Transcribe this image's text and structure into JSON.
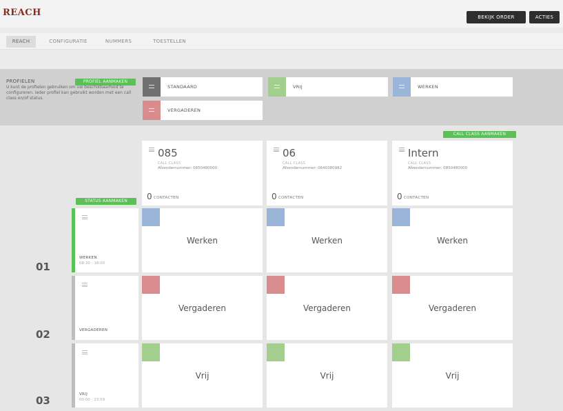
{
  "app": {
    "title": "REACH"
  },
  "header": {
    "order_button": "BEKIJK ORDER",
    "actions_button": "ACTIES"
  },
  "tabs": [
    "REACH",
    "CONFIGURATIE",
    "NUMMERS",
    "TOESTELLEN"
  ],
  "profiles": {
    "title": "PROFIELEN",
    "add_button": "PROFIEL AANMAKEN",
    "description": "U kunt de profielen gebruiken om uw beschikbaarheid te configureren. Ieder profiel kan gebruikt worden met een call class en/of status.",
    "items": [
      {
        "name": "STANDAARD",
        "color": "#707070"
      },
      {
        "name": "VRIJ",
        "color": "#a3cf8e"
      },
      {
        "name": "WERKEN",
        "color": "#9ab5d8"
      },
      {
        "name": "VERGADEREN",
        "color": "#d88c8e"
      }
    ]
  },
  "call_classes": {
    "add_button": "CALL CLASS AANMAKEN",
    "items": [
      {
        "name": "085",
        "label": "CALL CLASS",
        "sender": "Afzendernummer: 0850480000",
        "count": "0",
        "count_label": "CONTACTEN"
      },
      {
        "name": "06",
        "label": "CALL CLASS",
        "sender": "Afzendernummer: 0640380982",
        "count": "0",
        "count_label": "CONTACTEN"
      },
      {
        "name": "Intern",
        "label": "CALL CLASS",
        "sender": "Afzendernummer: 0850480000",
        "count": "0",
        "count_label": "CONTACTEN"
      }
    ]
  },
  "statuses": {
    "add_button": "STATUS AANMAKEN",
    "items": [
      {
        "number": "01",
        "name": "WERKEN",
        "time": "08:30 - 18:00",
        "bar_color": "#5cbf58",
        "cells": [
          {
            "label": "Werken",
            "color": "#9ab5d8"
          },
          {
            "label": "Werken",
            "color": "#9ab5d8"
          },
          {
            "label": "Werken",
            "color": "#9ab5d8"
          }
        ]
      },
      {
        "number": "02",
        "name": "VERGADEREN",
        "time": "",
        "bar_color": "#bdbdbd",
        "cells": [
          {
            "label": "Vergaderen",
            "color": "#d88c8e"
          },
          {
            "label": "Vergaderen",
            "color": "#d88c8e"
          },
          {
            "label": "Vergaderen",
            "color": "#d88c8e"
          }
        ]
      },
      {
        "number": "03",
        "name": "VRIJ",
        "time": "00:00 - 23:59",
        "bar_color": "#bdbdbd",
        "cells": [
          {
            "label": "Vrij",
            "color": "#a3cf8e"
          },
          {
            "label": "Vrij",
            "color": "#a3cf8e"
          },
          {
            "label": "Vrij",
            "color": "#a3cf8e"
          }
        ]
      }
    ]
  }
}
